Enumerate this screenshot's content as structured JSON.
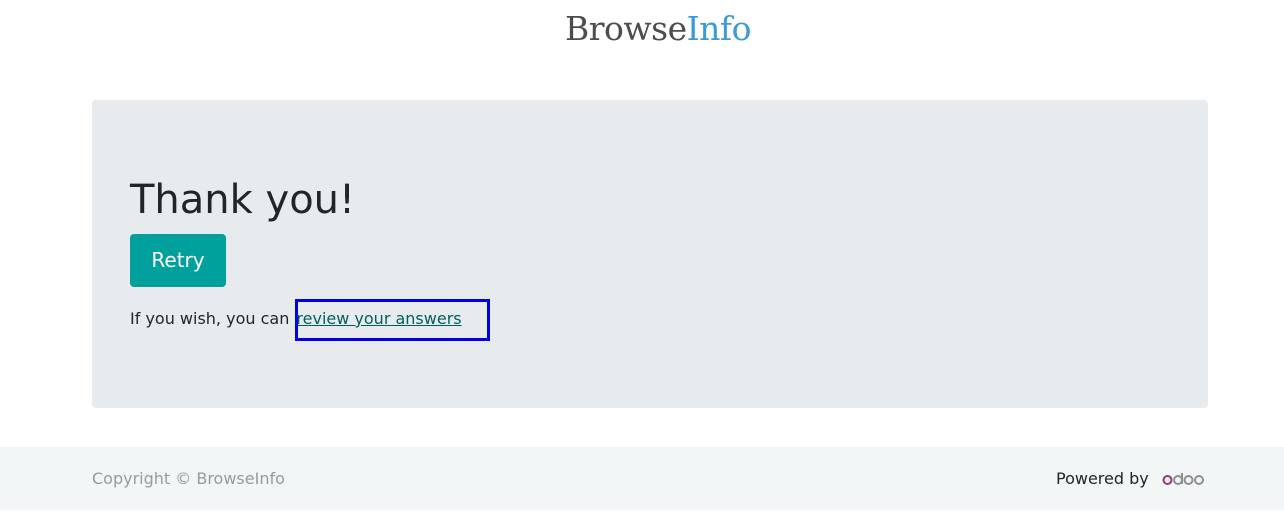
{
  "header": {
    "logo_part1": "Browse",
    "logo_part2": "Info"
  },
  "main": {
    "title": "Thank you!",
    "retry_label": "Retry",
    "review_prefix": "If you wish, you can",
    "review_link": "review your answers"
  },
  "footer": {
    "copyright": "Copyright © BrowseInfo",
    "powered_by": "Powered by",
    "powered_logo": "odoo"
  },
  "colors": {
    "accent": "#00a09d",
    "logo_info": "#3b9ad8",
    "link": "#005f5d",
    "highlight": "#0000e6"
  }
}
